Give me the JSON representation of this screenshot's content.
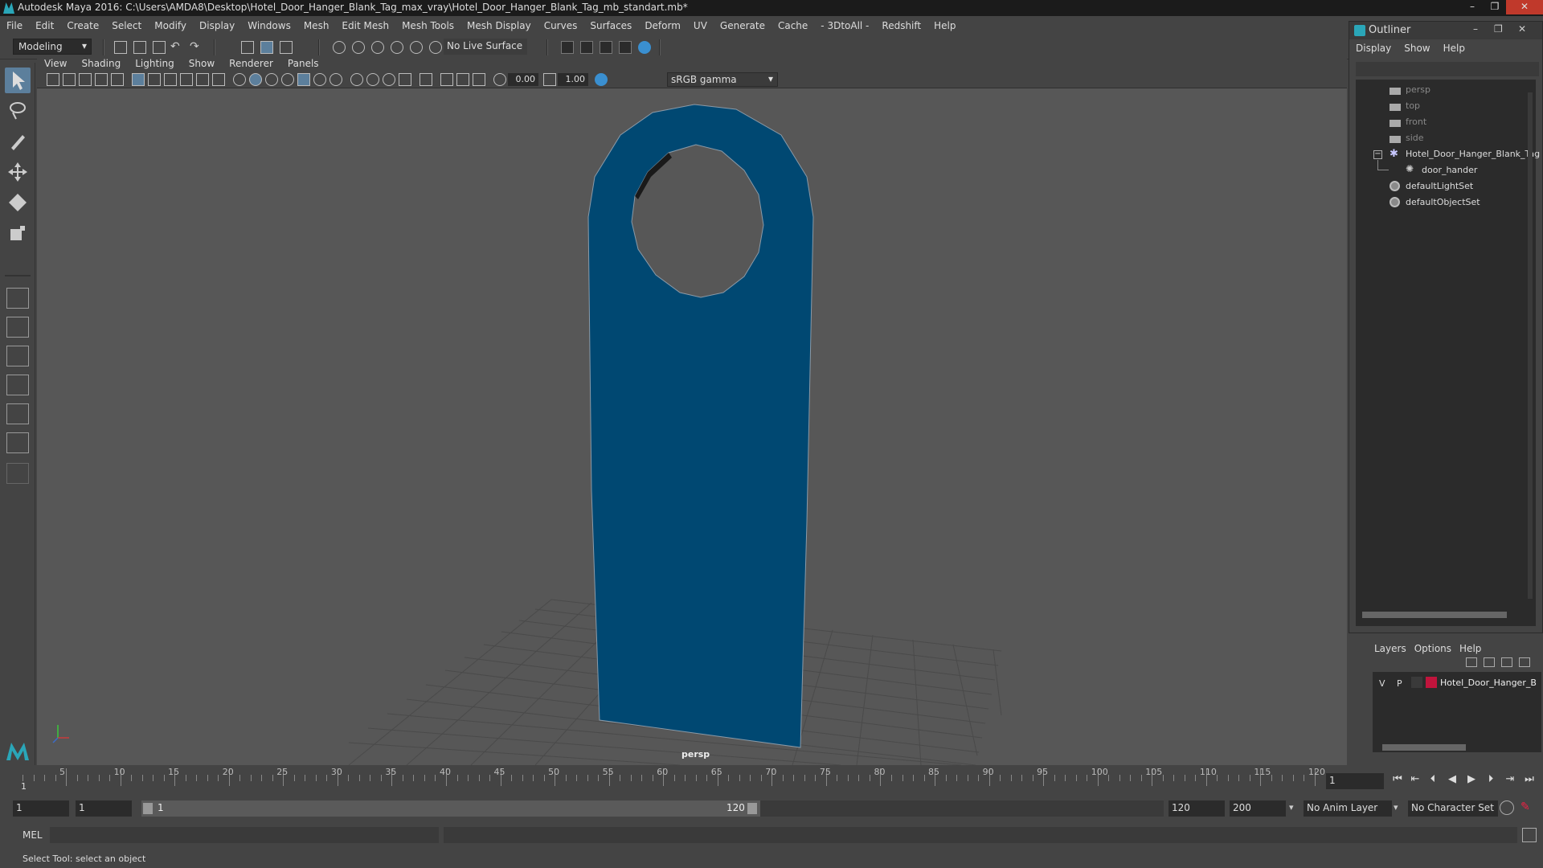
{
  "window": {
    "title": "Autodesk Maya 2016: C:\\Users\\AMDA8\\Desktop\\Hotel_Door_Hanger_Blank_Tag_max_vray\\Hotel_Door_Hanger_Blank_Tag_mb_standart.mb*",
    "minimize": "–",
    "maximize": "❐",
    "close": "✕"
  },
  "menubar": {
    "items": [
      "File",
      "Edit",
      "Create",
      "Select",
      "Modify",
      "Display",
      "Windows",
      "Mesh",
      "Edit Mesh",
      "Mesh Tools",
      "Mesh Display",
      "Curves",
      "Surfaces",
      "Deform",
      "UV",
      "Generate",
      "Cache",
      "- 3DtoAll -",
      "Redshift",
      "Help"
    ]
  },
  "shelf": {
    "mode": "Modeling",
    "live_surface": "No Live Surface"
  },
  "viewport": {
    "menu": [
      "View",
      "Shading",
      "Lighting",
      "Show",
      "Renderer",
      "Panels"
    ],
    "exposure": "0.00",
    "gamma_value": "1.00",
    "color_space": "sRGB gamma",
    "camera_label": "persp",
    "accent_color": "#004872"
  },
  "outliner": {
    "title": "Outliner",
    "menu": [
      "Display",
      "Show",
      "Help"
    ],
    "items": [
      {
        "label": "persp",
        "kind": "camera-icon"
      },
      {
        "label": "top",
        "kind": "camera-icon"
      },
      {
        "label": "front",
        "kind": "camera-icon"
      },
      {
        "label": "side",
        "kind": "camera-icon"
      },
      {
        "label": "Hotel_Door_Hanger_Blank_Tag",
        "kind": "group-icon"
      },
      {
        "label": "door_hander",
        "kind": "mesh-icon"
      },
      {
        "label": "defaultLightSet",
        "kind": "set-icon"
      },
      {
        "label": "defaultObjectSet",
        "kind": "set-icon"
      }
    ],
    "expand_glyph": "−"
  },
  "layers": {
    "menu": [
      "Layers",
      "Options",
      "Help"
    ],
    "row": {
      "v": "V",
      "p": "P",
      "name": "Hotel_Door_Hanger_B",
      "color": "#c0143c"
    }
  },
  "timeline": {
    "ticks": [
      "5",
      "10",
      "15",
      "20",
      "25",
      "30",
      "35",
      "40",
      "45",
      "50",
      "55",
      "60",
      "65",
      "70",
      "75",
      "80",
      "85",
      "90",
      "95",
      "100",
      "105",
      "110",
      "115",
      "120"
    ],
    "start_label": "1",
    "current_frame": "1"
  },
  "range": {
    "start": "1",
    "playback_start": "1",
    "slider_start": "1",
    "slider_end": "120",
    "playback_end": "120",
    "end": "200",
    "anim_layer": "No Anim Layer",
    "character_set": "No Character Set"
  },
  "command": {
    "language": "MEL"
  },
  "help_line": "Select Tool: select an object"
}
